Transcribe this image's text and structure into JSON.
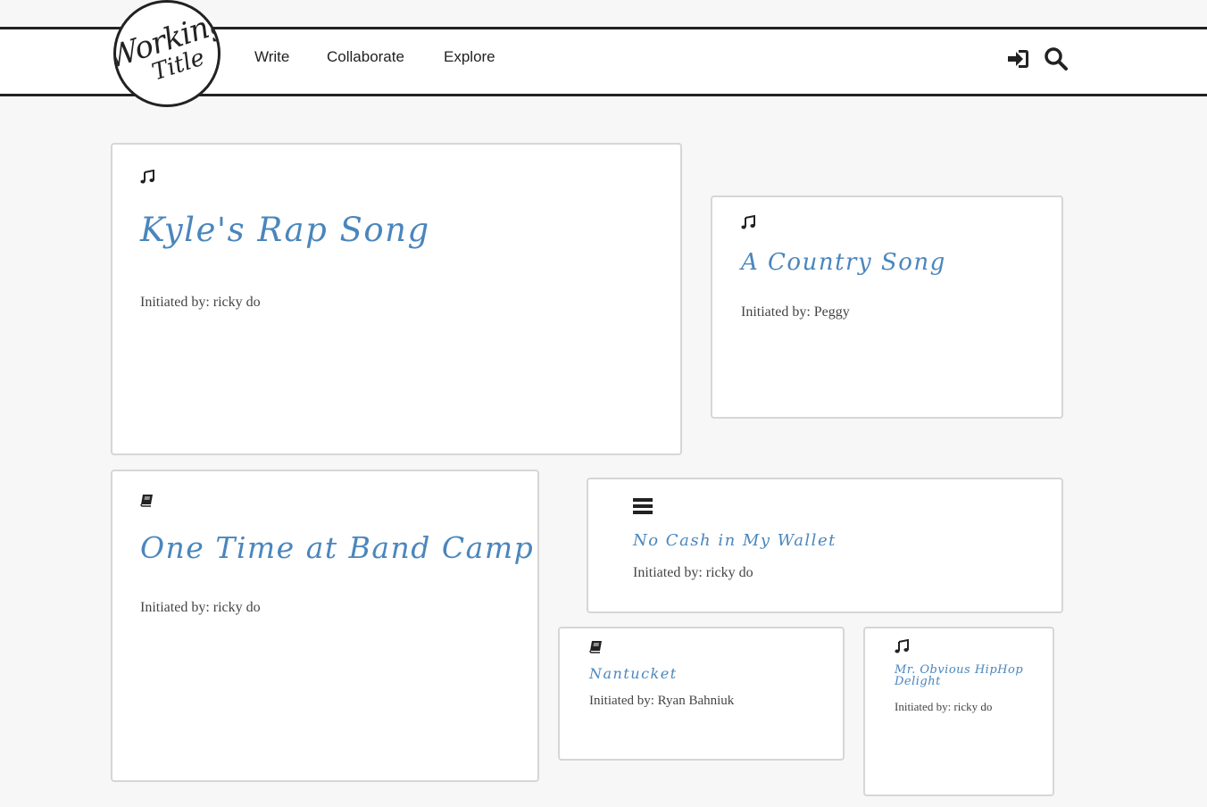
{
  "brand": {
    "logo_line1": "Working",
    "logo_line2": "Title"
  },
  "nav": {
    "write": "Write",
    "collaborate": "Collaborate",
    "explore": "Explore",
    "login_icon": "sign-in-icon",
    "search_icon": "search-icon"
  },
  "cards": [
    {
      "icon": "music-note-icon",
      "title": "Kyle's Rap Song",
      "initiated": "Initiated by: ricky do"
    },
    {
      "icon": "music-note-icon",
      "title": "A Country Song",
      "initiated": "Initiated by: Peggy"
    },
    {
      "icon": "book-icon",
      "title": "One Time at Band Camp",
      "initiated": "Initiated by: ricky do"
    },
    {
      "icon": "list-lines-icon",
      "title": "No Cash in My Wallet",
      "initiated": "Initiated by: ricky do"
    },
    {
      "icon": "book-icon",
      "title": "Nantucket",
      "initiated": "Initiated by: Ryan Bahniuk"
    },
    {
      "icon": "music-note-icon",
      "title": "Mr. Obvious HipHop Delight",
      "initiated": "Initiated by: ricky do"
    }
  ],
  "colors": {
    "title_blue": "#4a86bd",
    "border": "#d6d6d6",
    "background": "#f7f7f7"
  }
}
